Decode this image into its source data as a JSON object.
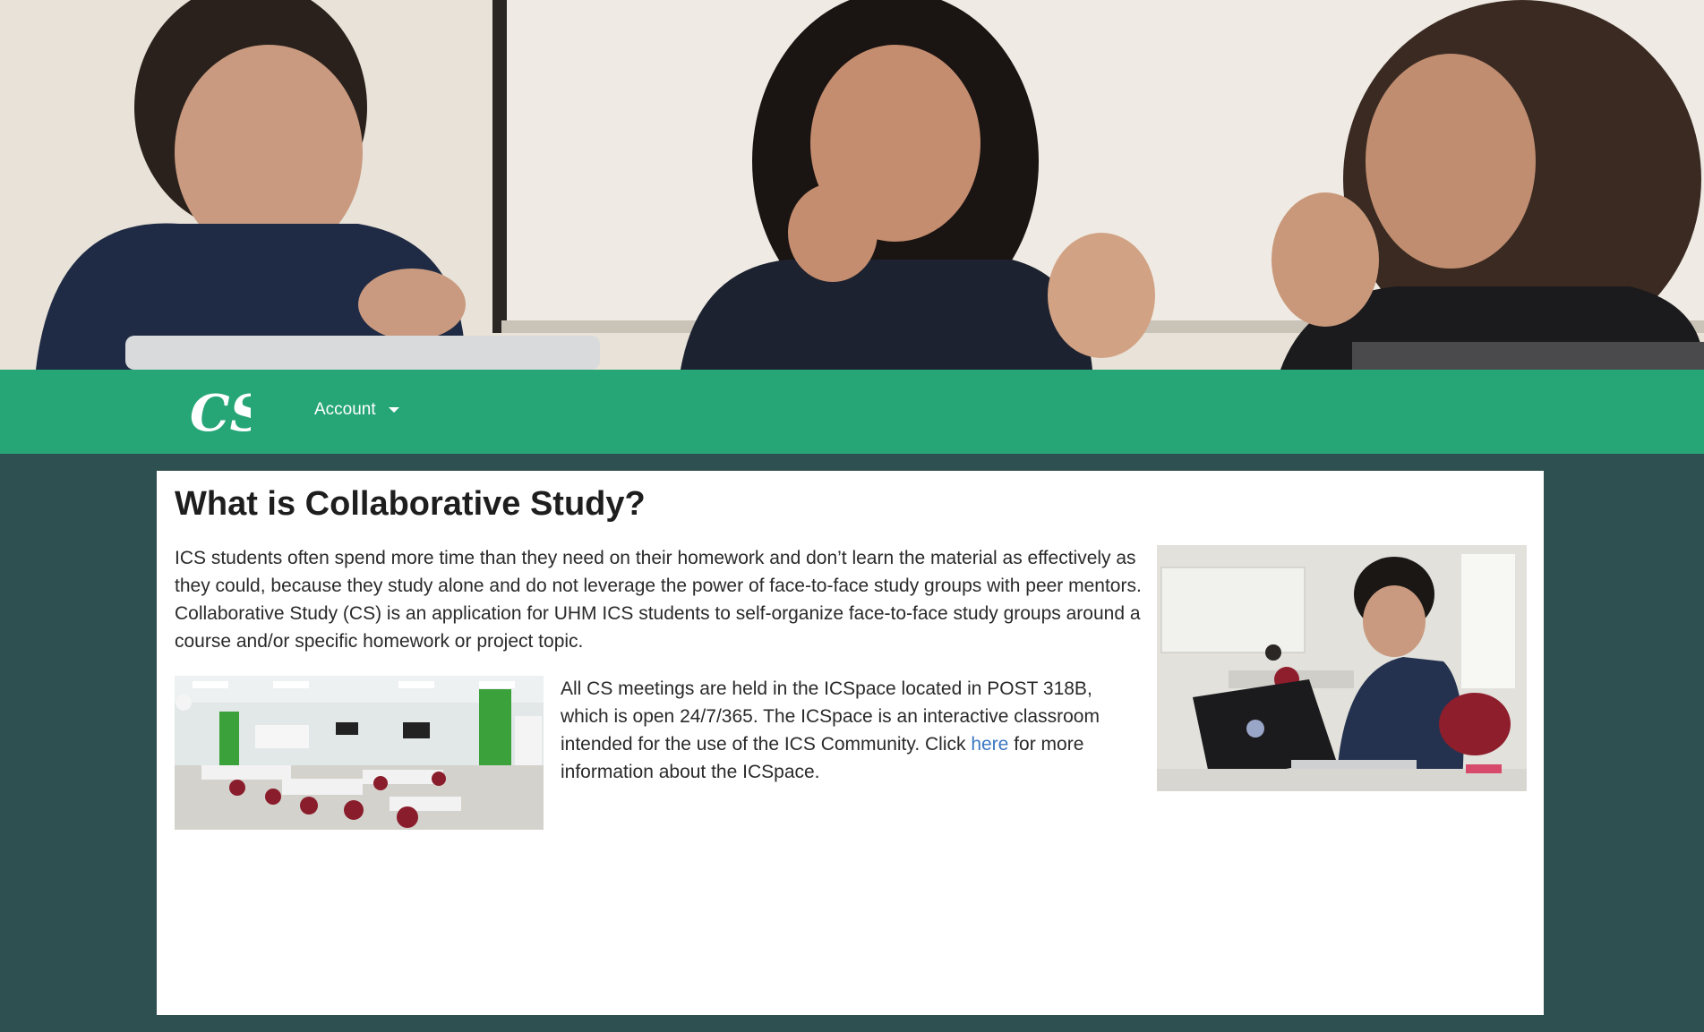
{
  "hero": {
    "image": "students-laughing-banner"
  },
  "navbar": {
    "logo_text": "CS",
    "account_label": "Account"
  },
  "content": {
    "title": "What is Collaborative Study?",
    "intro": "ICS students often spend more time than they need on their homework and don’t learn the material as effectively as they could, because they study alone and do not leverage the power of face-to-face study groups with peer mentors. Collaborative Study (CS) is an application for UHM ICS students to self-organize face-to-face study groups around a course and/or specific homework or project topic.",
    "meetings_before": "All CS meetings are held in the ICSpace located in POST 318B, which is open 24/7/365. The ICSpace is an interactive classroom intended for the use of the ICS Community. Click ",
    "meetings_link": "here",
    "meetings_after": " for more information about the ICSpace."
  },
  "colors": {
    "nav_green": "#26a677",
    "page_background": "#2e5050",
    "link": "#3d78c2"
  }
}
